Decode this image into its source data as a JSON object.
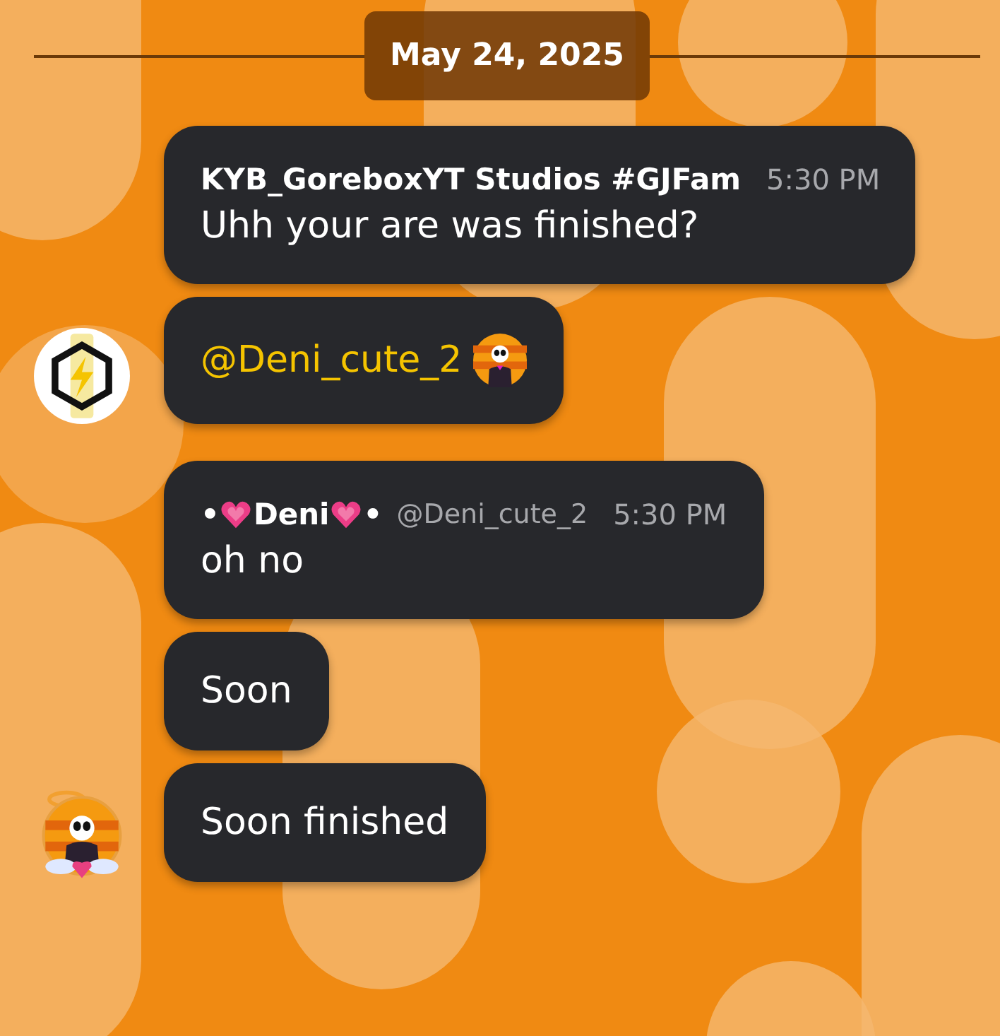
{
  "date_separator": "May 24, 2025",
  "groups": [
    {
      "avatar": {
        "kind": "badge"
      },
      "messages": [
        {
          "kind": "header",
          "author": {
            "name": "KYB_GoreboxYT Studios #GJFam"
          },
          "time": "5:30 PM",
          "text": "Uhh your are was finished?"
        },
        {
          "kind": "mention",
          "mention": "@Deni_cute_2"
        }
      ]
    },
    {
      "avatar": {
        "kind": "figure"
      },
      "messages": [
        {
          "kind": "header",
          "author": {
            "name_prefix": "•",
            "name": "Deni",
            "name_suffix": "•",
            "handle": "@Deni_cute_2"
          },
          "time": "5:30 PM",
          "text": "oh no"
        },
        {
          "kind": "plain",
          "text": "Soon"
        },
        {
          "kind": "plain",
          "text": "Soon finished"
        }
      ]
    }
  ]
}
